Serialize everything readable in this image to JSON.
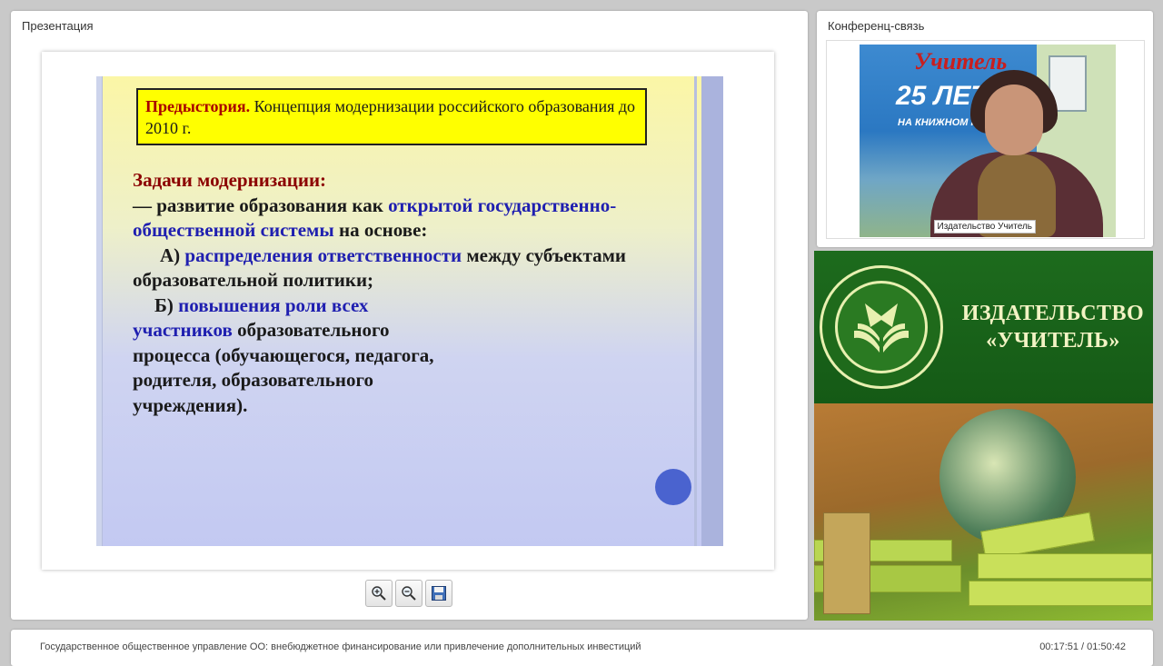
{
  "presentation": {
    "title": "Презентация",
    "slide": {
      "history_lead": "Предыстория.",
      "history_text": " Концепция модернизации российского образования до 2010 г.",
      "tasks_heading": "Задачи модернизации:",
      "line1_a": "— развитие образования как ",
      "line1_b": "открытой государственно-общественной системы",
      "line1_c": " на основе:",
      "item_a_prefix": "А) ",
      "item_a_blue": "распределения ответственности",
      "item_a_rest": " между субъектами образовательной политики;",
      "item_b_prefix": "Б) ",
      "item_b_blue": "повышения роли всех участников",
      "item_b_rest": " образовательного процесса (обучающегося, педагога, родителя, образовательного учреждения)."
    },
    "toolbar": {
      "zoom_in_icon": "zoom-in-icon",
      "zoom_out_icon": "zoom-out-icon",
      "save_icon": "floppy-disk-icon"
    }
  },
  "conference": {
    "title": "Конференц-связь",
    "video_label": "Издательство Учитель",
    "banner_word": "Учитель",
    "banner_years": "25 ЛЕТ",
    "banner_sub": "НА КНИЖНОМ РЫНКЕ РОССИИ"
  },
  "publisher": {
    "name_line1": "ИЗДАТЕЛЬСТВО",
    "name_line2": "«УЧИТЕЛЬ»"
  },
  "footer": {
    "title": "Государственное общественное управление ОО: внебюджетное финансирование или привлечение дополнительных инвестиций",
    "time": "00:17:51 / 01:50:42"
  },
  "colors": {
    "accent_green": "#1d6b1d",
    "slide_red": "#8b0000",
    "slide_blue": "#1f1fb0",
    "highlight_yellow": "#ffff00"
  }
}
